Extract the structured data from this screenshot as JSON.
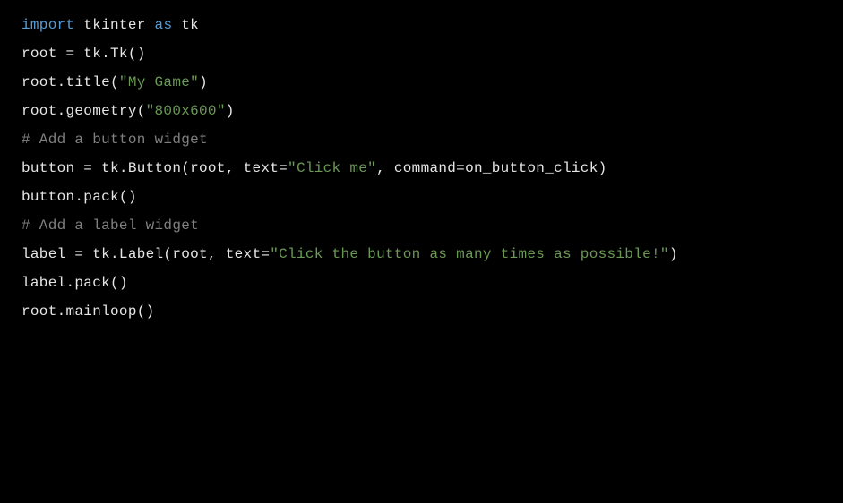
{
  "code": {
    "line1": {
      "import": "import",
      "module": " tkinter ",
      "as": "as",
      "alias": " tk"
    },
    "line2": "",
    "line3": "root = tk.Tk()",
    "line4": {
      "prefix": "root.title(",
      "string": "\"My Game\"",
      "suffix": ")"
    },
    "line5": {
      "prefix": "root.geometry(",
      "string": "\"800x600\"",
      "suffix": ")"
    },
    "line6": "",
    "line7": "# Add a button widget",
    "line8": {
      "prefix": "button = tk.Button(root, text=",
      "string": "\"Click me\"",
      "suffix": ", command=on_button_click)"
    },
    "line9": "button.pack()",
    "line10": "",
    "line11": "# Add a label widget",
    "line12": {
      "prefix": "label = tk.Label(root, text=",
      "string": "\"Click the button as many times as possible!\"",
      "suffix": ")"
    },
    "line13": "label.pack()",
    "line14": "",
    "line15": "root.mainloop()"
  }
}
